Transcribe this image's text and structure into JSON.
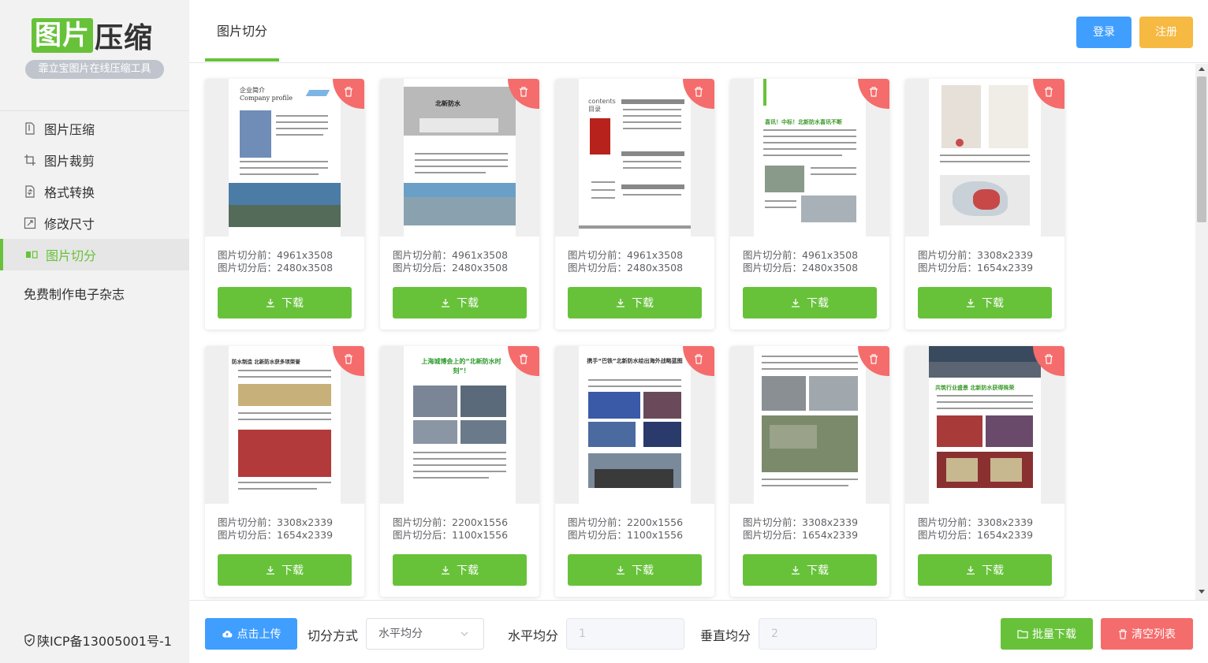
{
  "sidebar": {
    "logo_highlight": "图片",
    "logo_rest": "压缩",
    "logo_subtitle": "霏立宝图片在线压缩工具",
    "menu": [
      {
        "label": "图片压缩",
        "icon": "file-compress-icon"
      },
      {
        "label": "图片裁剪",
        "icon": "crop-icon"
      },
      {
        "label": "格式转换",
        "icon": "file-convert-icon"
      },
      {
        "label": "修改尺寸",
        "icon": "resize-icon"
      },
      {
        "label": "图片切分",
        "icon": "split-icon",
        "active": true
      }
    ],
    "extra_link": "免费制作电子杂志",
    "icp": "陕ICP备13005001号-1"
  },
  "header": {
    "tab": "图片切分",
    "login": "登录",
    "register": "注册"
  },
  "cards": [
    {
      "before": "图片切分前：4961x3508",
      "after": "图片切分后：2480x3508",
      "download": "下载",
      "thumb": "企业简介 Company profile"
    },
    {
      "before": "图片切分前：4961x3508",
      "after": "图片切分后：2480x3508",
      "download": "下载",
      "thumb": "北新防水"
    },
    {
      "before": "图片切分前：4961x3508",
      "after": "图片切分后：2480x3508",
      "download": "下载",
      "thumb": "contents 目录"
    },
    {
      "before": "图片切分前：4961x3508",
      "after": "图片切分后：2480x3508",
      "download": "下载",
      "thumb": "喜讯！中标！北新防水喜讯不断"
    },
    {
      "before": "图片切分前：3308x2339",
      "after": "图片切分后：1654x2339",
      "download": "下载",
      "thumb": ""
    },
    {
      "before": "图片切分前：3308x2339",
      "after": "图片切分后：1654x2339",
      "download": "下载",
      "thumb": "防水制造 北新防水获多项荣誉"
    },
    {
      "before": "图片切分前：2200x1556",
      "after": "图片切分后：1100x1556",
      "download": "下载",
      "thumb": "上海城博会上的“北新防水时刻”！"
    },
    {
      "before": "图片切分前：2200x1556",
      "after": "图片切分后：1100x1556",
      "download": "下载",
      "thumb": "携手“巴铁”北新防水绘出海外战略蓝图"
    },
    {
      "before": "图片切分前：3308x2339",
      "after": "图片切分后：1654x2339",
      "download": "下载",
      "thumb": ""
    },
    {
      "before": "图片切分前：3308x2339",
      "after": "图片切分后：1654x2339",
      "download": "下载",
      "thumb": "共筑行业盛景 北新防水获得殊荣"
    }
  ],
  "footer": {
    "upload": "点击上传",
    "split_mode_label": "切分方式",
    "split_mode_value": "水平均分",
    "horizontal_label": "水平均分",
    "horizontal_value": "1",
    "vertical_label": "垂直均分",
    "vertical_value": "2",
    "batch_download": "批量下载",
    "clear_list": "清空列表"
  },
  "colors": {
    "primary_green": "#67c23a",
    "blue": "#409eff",
    "orange": "#f6b942",
    "red": "#f56c6c"
  }
}
